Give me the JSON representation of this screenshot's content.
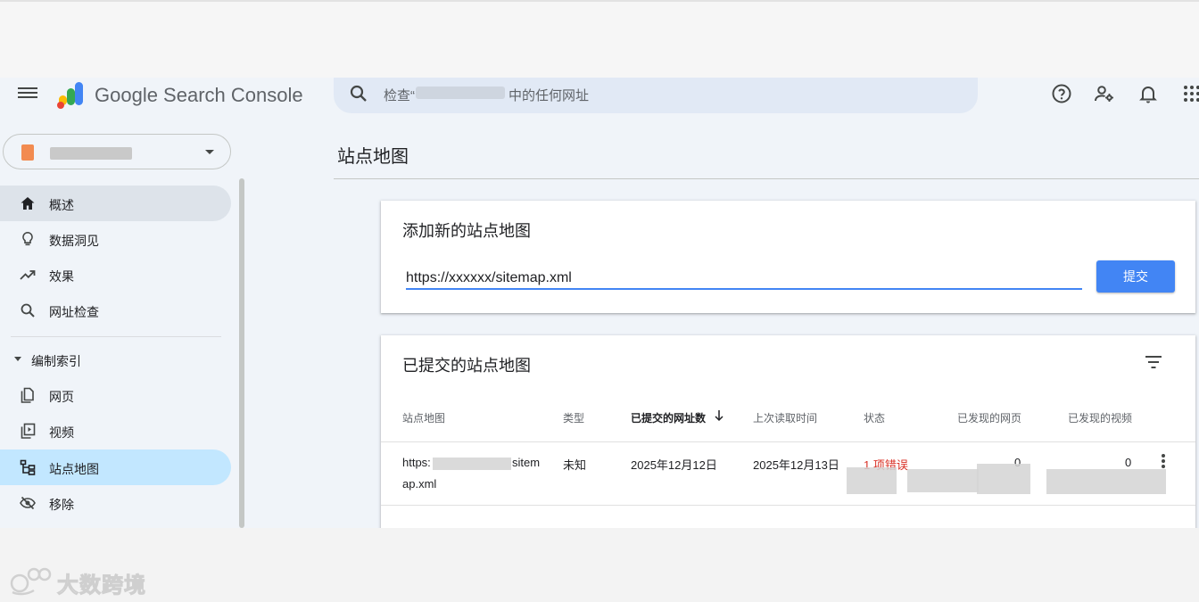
{
  "header": {
    "brand": "Google Search Console",
    "search": {
      "placeholder_prefix": "检查“",
      "placeholder_suffix": "中的任何网址"
    }
  },
  "sidebar": {
    "items": [
      {
        "label": "概述",
        "icon": "home-icon"
      },
      {
        "label": "数据洞见",
        "icon": "lightbulb-icon"
      },
      {
        "label": "效果",
        "icon": "trending-up-icon"
      },
      {
        "label": "网址检查",
        "icon": "search-icon"
      }
    ],
    "section": "编制索引",
    "index_items": [
      {
        "label": "网页",
        "icon": "pages-icon"
      },
      {
        "label": "视频",
        "icon": "video-icon"
      },
      {
        "label": "站点地图",
        "icon": "sitemap-icon"
      },
      {
        "label": "移除",
        "icon": "visibility-off-icon"
      }
    ]
  },
  "main": {
    "page_title": "站点地图",
    "add_card": {
      "title": "添加新的站点地图",
      "input_value": "https://xxxxxx/sitemap.xml",
      "submit_label": "提交"
    },
    "submitted_card": {
      "title": "已提交的站点地图",
      "columns": [
        "站点地图",
        "类型",
        "已提交的网址数",
        "上次读取时间",
        "状态",
        "已发现的网页",
        "已发现的视频"
      ],
      "rows": [
        {
          "sitemap_prefix": "https:",
          "sitemap_suffix": "sitem",
          "sitemap_line2": "ap.xml",
          "type": "未知",
          "submitted": "2025年12月12日",
          "last_read": "2025年12月13日",
          "status": "1 项错误",
          "pages": "0",
          "videos": "0"
        }
      ]
    }
  },
  "watermark": {
    "text": "大数跨境"
  },
  "colors": {
    "accent": "#4285f4",
    "error": "#d93025",
    "active_nav": "#c2e7ff"
  }
}
